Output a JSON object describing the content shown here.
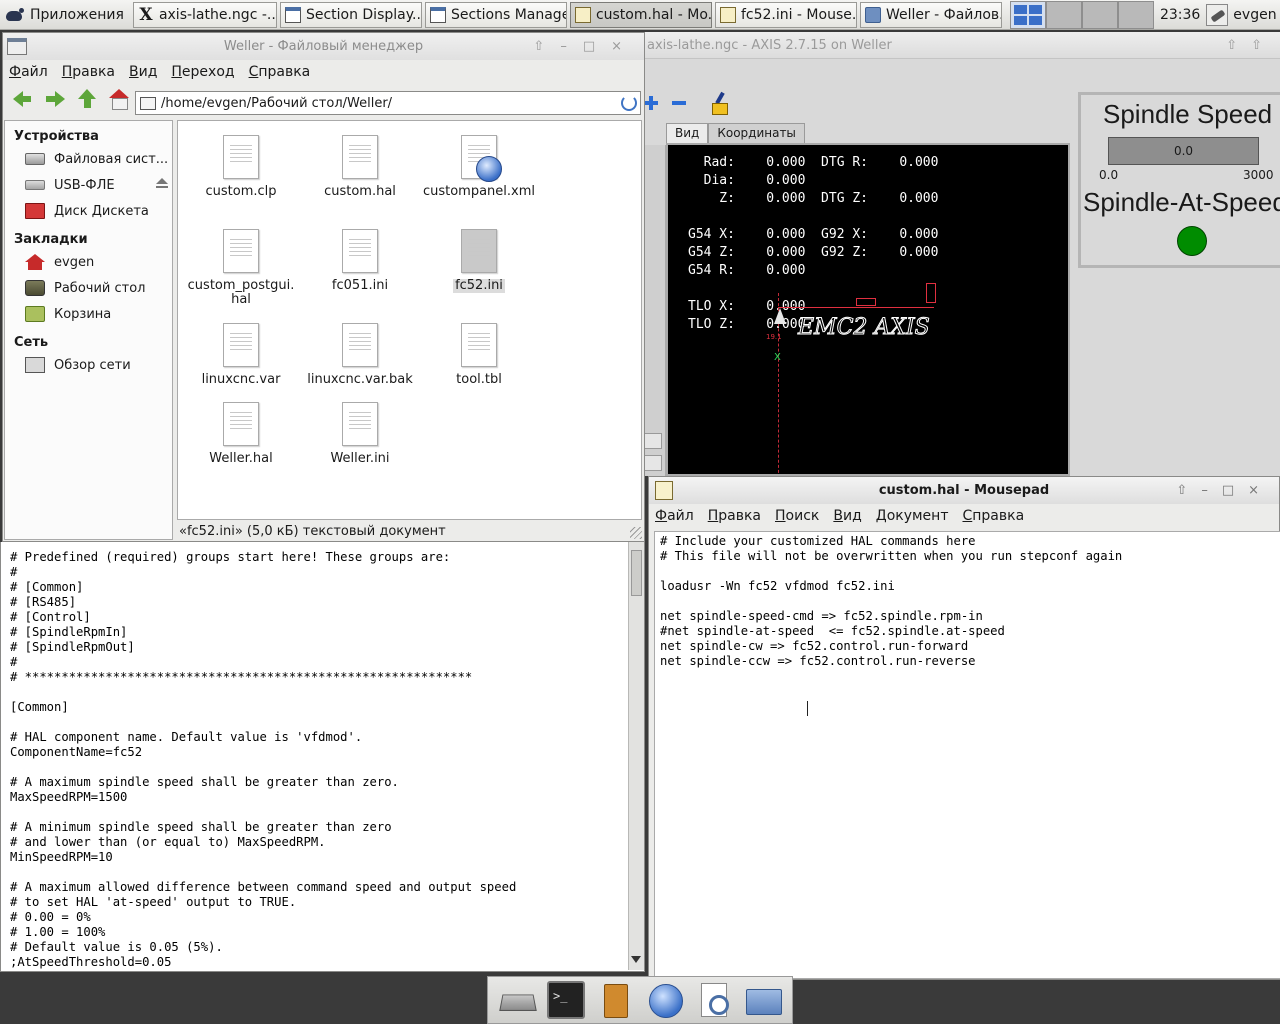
{
  "top_panel": {
    "app_menu": "Приложения",
    "tasks": [
      {
        "label": "axis-lathe.ngc -...",
        "icon": "x-icon"
      },
      {
        "label": "Section Display...",
        "icon": "window-icon"
      },
      {
        "label": "Sections Manager",
        "icon": "window-icon"
      },
      {
        "label": "custom.hal - Mo...",
        "icon": "mousepad-icon"
      },
      {
        "label": "fc52.ini - Mouse...",
        "icon": "mousepad-icon"
      },
      {
        "label": "Weller - Файлов...",
        "icon": "folder-icon"
      }
    ],
    "clock": "23:36",
    "user": "evgen"
  },
  "axis": {
    "title": "axis-lathe.ngc - AXIS 2.7.15 on Weller",
    "tabs": [
      "Вид",
      "Координаты"
    ],
    "dro": [
      "  Rad:    0.000  DTG R:    0.000",
      "  Dia:    0.000",
      "    Z:    0.000  DTG Z:    0.000",
      "",
      "G54 X:    0.000  G92 X:    0.000",
      "G54 Z:    0.000  G92 Z:    0.000",
      "G54 R:    0.000",
      "",
      "TLO X:    0.000",
      "TLO Z:    0.000"
    ],
    "emc_text": "EMC2 AXIS",
    "pyvcp": {
      "speed_label": "Spindle Speed",
      "speed_value": "0.0",
      "speed_min": "0.0",
      "speed_max": "3000",
      "at_speed_label": "Spindle-At-Speed",
      "led_color": "#008c00"
    }
  },
  "file_manager": {
    "title": "Weller - Файловый менеджер",
    "menu": [
      "Файл",
      "Правка",
      "Вид",
      "Переход",
      "Справка"
    ],
    "path": "/home/evgen/Рабочий стол/Weller/",
    "sidebar": {
      "devices_header": "Устройства",
      "devices": [
        "Файловая сист...",
        "USB-ФЛЕ",
        "Диск Дискета"
      ],
      "bookmarks_header": "Закладки",
      "bookmarks": [
        "evgen",
        "Рабочий стол",
        "Корзина"
      ],
      "network_header": "Сеть",
      "network": [
        "Обзор сети"
      ]
    },
    "files": [
      "custom.clp",
      "custom.hal",
      "custompanel.xml",
      "custom_postgui.hal",
      "fc051.ini",
      "fc52.ini",
      "linuxcnc.var",
      "linuxcnc.var.bak",
      "tool.tbl",
      "Weller.hal",
      "Weller.ini"
    ],
    "selected_file": "fc52.ini",
    "status": "«fc52.ini» (5,0 кБ) текстовый документ"
  },
  "left_editor": {
    "text": "# Predefined (required) groups start here! These groups are:\n#\n# [Common]\n# [RS485]\n# [Control]\n# [SpindleRpmIn]\n# [SpindleRpmOut]\n#\n# *************************************************************\n\n[Common]\n\n# HAL component name. Default value is 'vfdmod'.\nComponentName=fc52\n\n# A maximum spindle speed shall be greater than zero.\nMaxSpeedRPM=1500\n\n# A minimum spindle speed shall be greater than zero\n# and lower than (or equal to) MaxSpeedRPM.\nMinSpeedRPM=10\n\n# A maximum allowed difference between command speed and output speed\n# to set HAL 'at-speed' output to TRUE.\n# 0.00 = 0%\n# 1.00 = 100%\n# Default value is 0.05 (5%).\n;AtSpeedThreshold=0.05"
  },
  "mousepad": {
    "title": "custom.hal - Mousepad",
    "menu": [
      "Файл",
      "Правка",
      "Поиск",
      "Вид",
      "Документ",
      "Справка"
    ],
    "text": "# Include your customized HAL commands here\n# This file will not be overwritten when you run stepconf again\n\nloadusr -Wn fc52 vfdmod fc52.ini\n\nnet spindle-speed-cmd => fc52.spindle.rpm-in\n#net spindle-at-speed  <= fc52.spindle.at-speed\nnet spindle-cw => fc52.control.run-forward\nnet spindle-ccw => fc52.control.run-reverse"
  }
}
